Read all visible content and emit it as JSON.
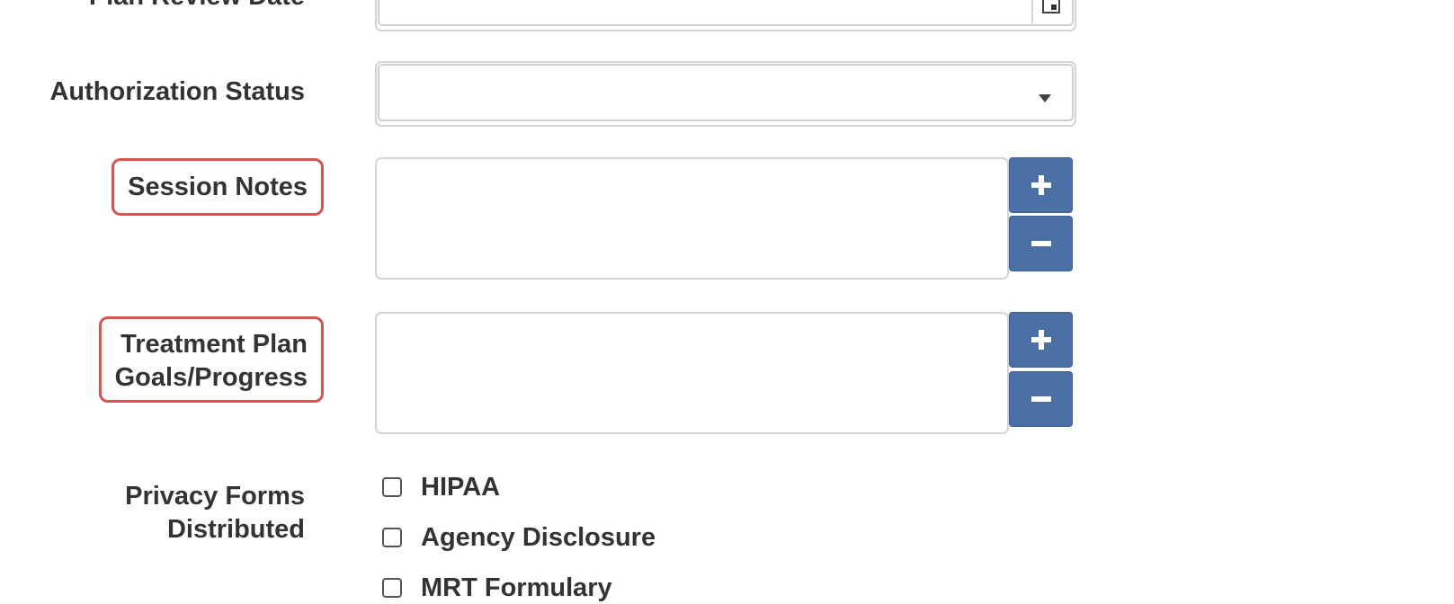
{
  "form": {
    "plan_review_date": {
      "label": "Plan Review Date",
      "value": "",
      "icon": "calendar-icon"
    },
    "authorization_status": {
      "label": "Authorization Status",
      "value": "",
      "icon": "dropdown-caret-icon"
    },
    "session_notes": {
      "label": "Session Notes",
      "value": "",
      "add_label": "+",
      "remove_label": "−"
    },
    "treatment_plan": {
      "label_line1": "Treatment Plan",
      "label_line2": "Goals/Progress",
      "value": "",
      "add_label": "+",
      "remove_label": "−"
    },
    "privacy_forms": {
      "label_line1": "Privacy Forms",
      "label_line2": "Distributed",
      "options": [
        {
          "label": "HIPAA",
          "checked": false
        },
        {
          "label": "Agency Disclosure",
          "checked": false
        },
        {
          "label": "MRT Formulary",
          "checked": false
        }
      ]
    }
  },
  "colors": {
    "accent": "#4a6fa5",
    "highlight": "#d9534f"
  }
}
